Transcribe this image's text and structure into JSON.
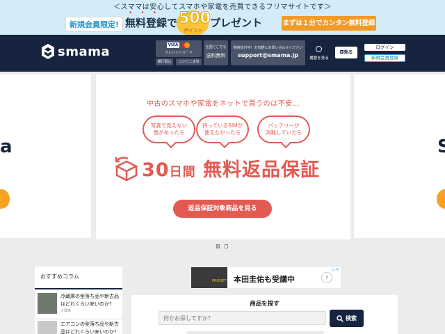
{
  "promo": {
    "tagline": "＜スママは安心してスマホや家電を売買できるフリマサイトです＞",
    "member_label": "新規会員限定!",
    "headline_pre": "無料登録で",
    "points_number": "500",
    "points_label": "ポイント",
    "headline_post": "プレゼント",
    "cta": "まずは１分でカンタン無料登録"
  },
  "header": {
    "logo_text": "smama",
    "visa": "VISA",
    "credit_card": "クレジットカード",
    "bank_transfer": "銀行振込",
    "convenience_pay": "コンビニ決済",
    "shipping_note": "全国どこでも",
    "shipping_free": "送料無料",
    "support_note": "随時受付中！お気軽にお問い合わせください",
    "support_email": "support@smama.jp",
    "history_label": "履歴を見る",
    "sell_label": "売る",
    "login_label": "ログイン",
    "register_label": "新規会員登録"
  },
  "carousel": {
    "side_left_text": "a",
    "side_right_text": "S",
    "question": "中古のスマホや家電をネットで買うのは不安…",
    "bubbles": [
      "写真で見えない\n傷があったら",
      "持っているSIMが\n使えなかったら",
      "バッテリーが\n消耗していたら"
    ],
    "guarantee_days": "30",
    "guarantee_unit": "日間",
    "guarantee_text": "無料返品保証",
    "cta": "返品保証対象商品を見る"
  },
  "sidebar": {
    "title": "おすすめコラム",
    "items": [
      {
        "title": "冷蔵庫の型落ち品や新古品はどれくらい安いのか?",
        "category": "冷蔵庫"
      },
      {
        "title": "エアコンの型落ち品や新古品はどれくらい安いのか?",
        "category": ""
      }
    ]
  },
  "ad": {
    "title": "本田圭佑も受講中",
    "image_text": "PROGET"
  },
  "search": {
    "title": "商品を探す",
    "placeholder": "何かお探しですか？",
    "button": "検索"
  },
  "colors": {
    "navy": "#16243f",
    "accent_red": "#e25a52",
    "orange": "#f29b28",
    "promo_bg": "#d3ecf7"
  }
}
